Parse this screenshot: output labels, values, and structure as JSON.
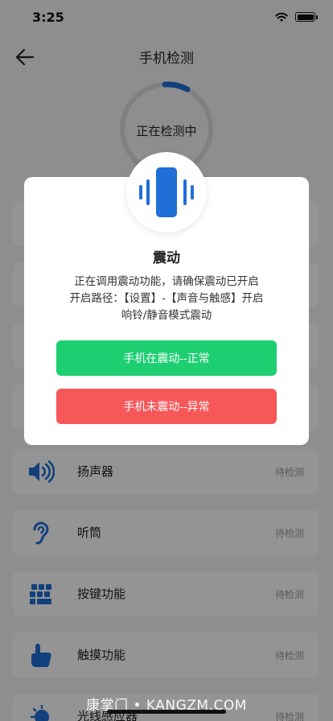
{
  "status_bar": {
    "time": "3:25"
  },
  "nav": {
    "title": "手机检测"
  },
  "progress": {
    "label": "正在检测中"
  },
  "list": [
    {
      "label": "",
      "status": ""
    },
    {
      "label": "",
      "status": ""
    },
    {
      "label": "",
      "status": ""
    },
    {
      "label": "",
      "status": ""
    },
    {
      "label": "扬声器",
      "status": "待检测",
      "icon": "speaker-icon"
    },
    {
      "label": "听筒",
      "status": "待检测",
      "icon": "ear-icon"
    },
    {
      "label": "按键功能",
      "status": "待检测",
      "icon": "keys-icon"
    },
    {
      "label": "触摸功能",
      "status": "待检测",
      "icon": "touch-icon"
    },
    {
      "label": "光线感应器",
      "status": "待检测",
      "icon": "light-sensor-icon"
    }
  ],
  "dialog": {
    "icon": "vibration-icon",
    "title": "震动",
    "line1": "正在调用震动功能，请确保震动已开启",
    "line2": "开启路径：【设置】-【声音与触感】开启",
    "line3": "响铃/静音模式震动",
    "ok_label": "手机在震动--正常",
    "bad_label": "手机未震动--异常"
  },
  "colors": {
    "accent": "#1f6fd6",
    "ok": "#1ecf72",
    "bad": "#f65759"
  },
  "watermark": "康掌门 • KANGZM.COM"
}
